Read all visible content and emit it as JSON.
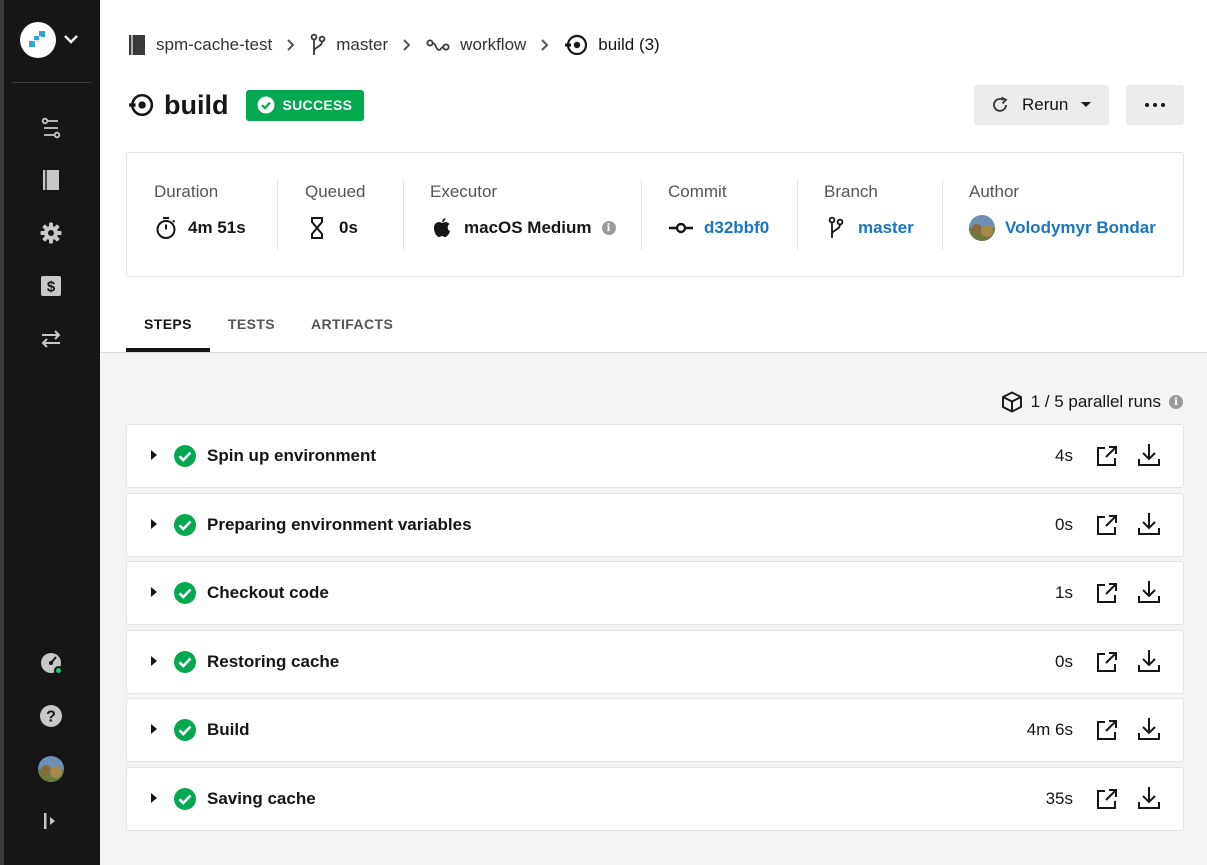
{
  "breadcrumb": {
    "project": "spm-cache-test",
    "branch": "master",
    "workflow": "workflow",
    "job": "build (3)"
  },
  "header": {
    "title": "build",
    "status": "SUCCESS",
    "rerun_label": "Rerun"
  },
  "stats": {
    "duration": {
      "label": "Duration",
      "value": "4m 51s"
    },
    "queued": {
      "label": "Queued",
      "value": "0s"
    },
    "executor": {
      "label": "Executor",
      "value": "macOS Medium"
    },
    "commit": {
      "label": "Commit",
      "value": "d32bbf0"
    },
    "branch": {
      "label": "Branch",
      "value": "master"
    },
    "author": {
      "label": "Author",
      "value": "Volodymyr Bondar"
    }
  },
  "tabs": [
    "STEPS",
    "TESTS",
    "ARTIFACTS"
  ],
  "parallel_runs": "1 / 5 parallel runs",
  "steps": [
    {
      "name": "Spin up environment",
      "duration": "4s"
    },
    {
      "name": "Preparing environment variables",
      "duration": "0s"
    },
    {
      "name": "Checkout code",
      "duration": "1s"
    },
    {
      "name": "Restoring cache",
      "duration": "0s"
    },
    {
      "name": "Build",
      "duration": "4m 6s"
    },
    {
      "name": "Saving cache",
      "duration": "35s"
    }
  ],
  "colors": {
    "success": "#04a84e",
    "link": "#1a76c3",
    "sidebar": "#161616"
  }
}
